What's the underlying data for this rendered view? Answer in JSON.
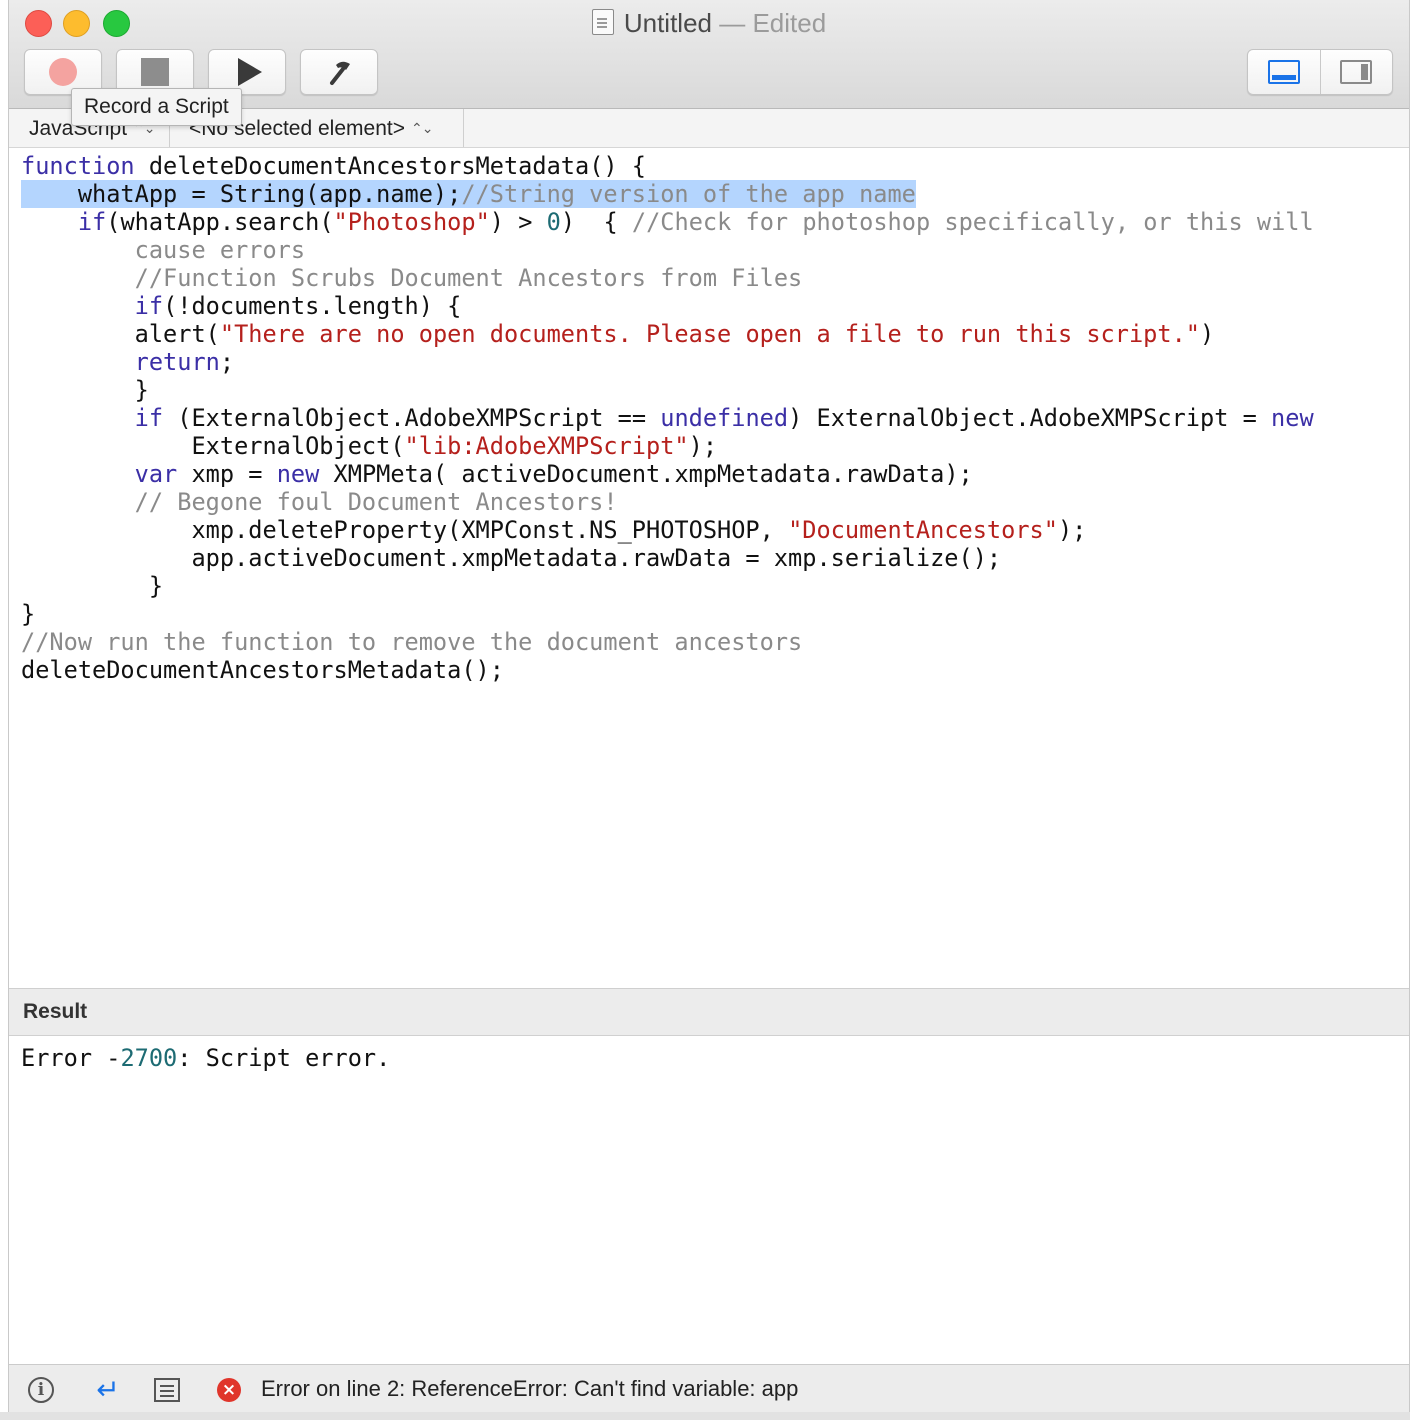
{
  "window": {
    "title": "Untitled",
    "title_suffix": "— Edited"
  },
  "toolbar": {
    "record_tooltip": "Record a Script",
    "buttons": [
      "record-button",
      "stop-button",
      "run-button",
      "compile-button"
    ],
    "view_toggle": [
      "show-bottom-pane-icon",
      "show-side-pane-icon"
    ]
  },
  "navbar": {
    "language": "JavaScript",
    "element": "<No selected element>"
  },
  "editor": {
    "lines": [
      [
        {
          "t": "function",
          "c": "kw"
        },
        {
          "t": " deleteDocumentAncestorsMetadata() {"
        }
      ],
      [
        {
          "t": "    whatApp = String(app.name);",
          "c": "hl"
        },
        {
          "t": "//String version of the app name",
          "c": "cmt hl"
        }
      ],
      [
        {
          "t": "    "
        },
        {
          "t": "if",
          "c": "kw"
        },
        {
          "t": "(whatApp.search("
        },
        {
          "t": "\"Photoshop\"",
          "c": "str"
        },
        {
          "t": ") > "
        },
        {
          "t": "0",
          "c": "num"
        },
        {
          "t": ")  { "
        },
        {
          "t": "//Check for photoshop specifically, or this will",
          "c": "cmt"
        }
      ],
      [
        {
          "t": "        cause errors",
          "c": "cmt"
        }
      ],
      [
        {
          "t": "        //Function Scrubs Document Ancestors from Files",
          "c": "cmt"
        }
      ],
      [
        {
          "t": "        "
        },
        {
          "t": "if",
          "c": "kw"
        },
        {
          "t": "(!documents.length) {"
        }
      ],
      [
        {
          "t": "        alert("
        },
        {
          "t": "\"There are no open documents. Please open a file to run this script.\"",
          "c": "str"
        },
        {
          "t": ")"
        }
      ],
      [
        {
          "t": "        "
        },
        {
          "t": "return",
          "c": "kw"
        },
        {
          "t": ";"
        }
      ],
      [
        {
          "t": "        }"
        }
      ],
      [
        {
          "t": "        "
        },
        {
          "t": "if",
          "c": "kw"
        },
        {
          "t": " (ExternalObject.AdobeXMPScript == "
        },
        {
          "t": "undefined",
          "c": "kw"
        },
        {
          "t": ") ExternalObject.AdobeXMPScript = "
        },
        {
          "t": "new",
          "c": "kw"
        }
      ],
      [
        {
          "t": "            ExternalObject("
        },
        {
          "t": "\"lib:AdobeXMPScript\"",
          "c": "str"
        },
        {
          "t": ");"
        }
      ],
      [
        {
          "t": "        "
        },
        {
          "t": "var",
          "c": "kw"
        },
        {
          "t": " xmp = "
        },
        {
          "t": "new",
          "c": "kw"
        },
        {
          "t": " XMPMeta( activeDocument.xmpMetadata.rawData);"
        }
      ],
      [
        {
          "t": "        // Begone foul Document Ancestors!",
          "c": "cmt"
        }
      ],
      [
        {
          "t": "            xmp.deleteProperty(XMPConst.NS_PHOTOSHOP, "
        },
        {
          "t": "\"DocumentAncestors\"",
          "c": "str"
        },
        {
          "t": ");"
        }
      ],
      [
        {
          "t": "            app.activeDocument.xmpMetadata.rawData = xmp.serialize();"
        }
      ],
      [
        {
          "t": "         }"
        }
      ],
      [
        {
          "t": "}"
        }
      ],
      [
        {
          "t": "//Now run the function to remove the document ancestors",
          "c": "cmt"
        }
      ],
      [
        {
          "t": "deleteDocumentAncestorsMetadata();"
        }
      ]
    ]
  },
  "result": {
    "header": "Result",
    "error_prefix": "Error -",
    "error_code": "2700",
    "error_suffix": ": Script error."
  },
  "statusbar": {
    "message": "Error on line 2: ReferenceError: Can't find variable: app"
  }
}
